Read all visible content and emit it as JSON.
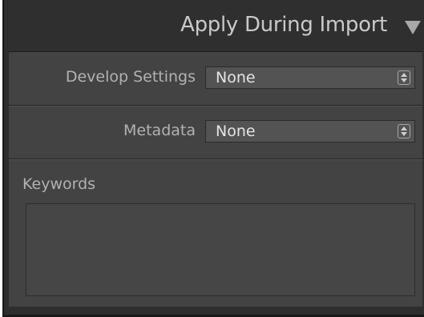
{
  "panel": {
    "title": "Apply During Import",
    "collapse_icon": "triangle-down-icon"
  },
  "fields": {
    "develop_settings": {
      "label": "Develop Settings",
      "value": "None"
    },
    "metadata": {
      "label": "Metadata",
      "value": "None"
    },
    "keywords": {
      "label": "Keywords",
      "value": ""
    }
  },
  "colors": {
    "panel_background": "#2e2e2e",
    "section_background": "#434343",
    "label_text": "#b2b2b2",
    "value_text": "#e4e4e4"
  }
}
